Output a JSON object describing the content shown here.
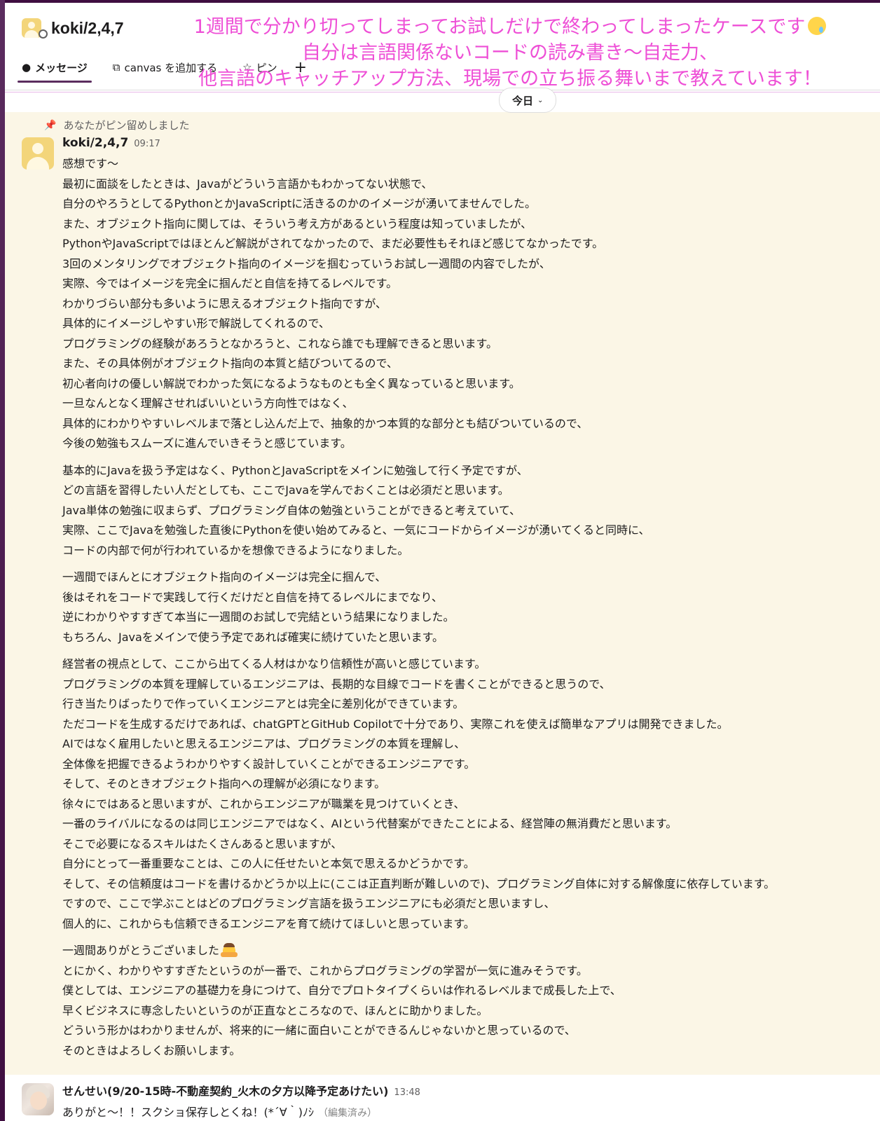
{
  "header": {
    "channel_name": "koki/2,4,7",
    "tabs": [
      {
        "label": "メッセージ",
        "icon": "message-bubble-icon"
      },
      {
        "label": "canvas を追加する",
        "icon": "canvas-add-icon"
      },
      {
        "label": "ピン",
        "icon": "pin-icon"
      }
    ],
    "add_tab_symbol": "+"
  },
  "annotation": {
    "line1": "1週間で分かり切ってしまってお試しだけで終わってしまったケースです",
    "line2": "自分は言語関係ないコードの読み書き〜自走力、",
    "line3": "他言語のキャッチアップ方法、現場での立ち振る舞いまで教えています！",
    "color": "#ee4fd6"
  },
  "date_divider": {
    "label": "今日",
    "chevron": "⌄"
  },
  "pinned_notice": "あなたがピン留めしました",
  "message1": {
    "sender": "koki/2,4,7",
    "time": "09:17",
    "paragraphs": [
      [
        "感想です〜",
        "最初に面談をしたときは、Javaがどういう言語かもわかってない状態で、",
        "自分のやろうとしてるPythonとかJavaScriptに活きるのかのイメージが湧いてませんでした。",
        "また、オブジェクト指向に関しては、そういう考え方があるという程度は知っていましたが、",
        "PythonやJavaScriptではほとんど解説がされてなかったので、まだ必要性もそれほど感じてなかったです。",
        "3回のメンタリングでオブジェクト指向のイメージを掴むっていうお試し一週間の内容でしたが、",
        "実際、今ではイメージを完全に掴んだと自信を持てるレベルです。",
        "わかりづらい部分も多いように思えるオブジェクト指向ですが、",
        "具体的にイメージしやすい形で解説してくれるので、",
        "プログラミングの経験があろうとなかろうと、これなら誰でも理解できると思います。",
        "また、その具体例がオブジェクト指向の本質と結びついてるので、",
        "初心者向けの優しい解説でわかった気になるようなものとも全く異なっていると思います。",
        "一旦なんとなく理解させればいいという方向性ではなく、",
        "具体的にわかりやすいレベルまで落とし込んだ上で、抽象的かつ本質的な部分とも結びついているので、",
        "今後の勉強もスムーズに進んでいきそうと感じています。"
      ],
      [
        "基本的にJavaを扱う予定はなく、PythonとJavaScriptをメインに勉強して行く予定ですが、",
        "どの言語を習得したい人だとしても、ここでJavaを学んでおくことは必須だと思います。",
        "Java単体の勉強に収まらず、プログラミング自体の勉強ということができると考えていて、",
        "実際、ここでJavaを勉強した直後にPythonを使い始めてみると、一気にコードからイメージが湧いてくると同時に、",
        "コードの内部で何が行われているかを想像できるようになりました。"
      ],
      [
        "一週間でほんとにオブジェクト指向のイメージは完全に掴んで、",
        "後はそれをコードで実践して行くだけだと自信を持てるレベルにまでなり、",
        "逆にわかりやすすぎて本当に一週間のお試しで完結という結果になりました。",
        "もちろん、Javaをメインで使う予定であれば確実に続けていたと思います。"
      ],
      [
        "経営者の視点として、ここから出てくる人材はかなり信頼性が高いと感じています。",
        "プログラミングの本質を理解しているエンジニアは、長期的な目線でコードを書くことができると思うので、",
        "行き当たりばったりで作っていくエンジニアとは完全に差別化ができています。",
        "ただコードを生成するだけであれば、chatGPTとGitHub Copilotで十分であり、実際これを使えば簡単なアプリは開発できました。",
        "AIではなく雇用したいと思えるエンジニアは、プログラミングの本質を理解し、",
        "全体像を把握できるようわかりやすく設計していくことができるエンジニアです。",
        "そして、そのときオブジェクト指向への理解が必須になります。",
        "徐々にではあると思いますが、これからエンジニアが職業を見つけていくとき、",
        "一番のライバルになるのは同じエンジニアではなく、AIという代替案ができたことによる、経営陣の無消費だと思います。",
        "そこで必要になるスキルはたくさんあると思いますが、",
        "自分にとって一番重要なことは、この人に任せたいと本気で思えるかどうかです。",
        "そして、その信頼度はコードを書けるかどうか以上に(ここは正直判断が難しいので)、プログラミング自体に対する解像度に依存しています。",
        "ですので、ここで学ぶことはどのプログラミング言語を扱うエンジニアにも必須だと思いますし、",
        "個人的に、これからも信頼できるエンジニアを育て続けてほしいと思っています。"
      ],
      [
        "一週間ありがとうございました",
        "とにかく、わかりやすすぎたというのが一番で、これからプログラミングの学習が一気に進みそうです。",
        "僕としては、エンジニアの基礎力を身につけて、自分でプロトタイプくらいは作れるレベルまで成長した上で、",
        "早くビジネスに専念したいというのが正直なところなので、ほんとに助かりました。",
        "どういう形かはわかりませんが、将来的に一緒に面白いことができるんじゃないかと思っているので、",
        "そのときはよろしくお願いします。"
      ]
    ]
  },
  "message2": {
    "sender": "せんせい(9/20-15時-不動産契約_火木の夕方以降予定あけたい)",
    "time": "13:48",
    "text": "ありがと〜！！スクショ保存しとくね！(*´∀｀)ﾉｼ",
    "edited_label": "（編集済み）"
  }
}
